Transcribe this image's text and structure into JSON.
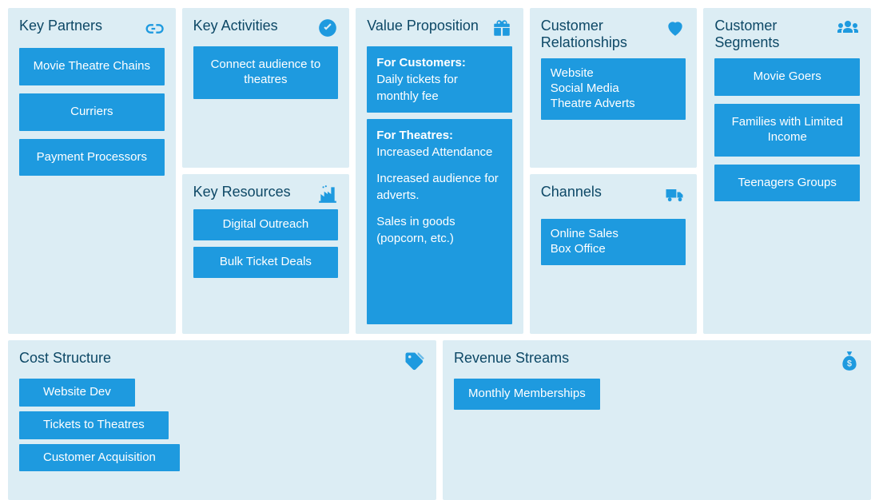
{
  "key_partners": {
    "title": "Key Partners",
    "items": [
      "Movie Theatre Chains",
      "Curriers",
      "Payment Processors"
    ]
  },
  "key_activities": {
    "title": "Key Activities",
    "items": [
      "Connect audience to theatres"
    ]
  },
  "key_resources": {
    "title": "Key Resources",
    "items": [
      "Digital Outreach",
      "Bulk Ticket Deals"
    ]
  },
  "value_proposition": {
    "title": "Value Proposition",
    "customers_heading": "For Customers:",
    "customers_body": "Daily tickets for monthly fee",
    "theatres_heading": "For Theatres:",
    "theatres_p1": "Increased Attendance",
    "theatres_p2": "Increased audience for adverts.",
    "theatres_p3": "Sales in goods (popcorn, etc.)"
  },
  "customer_relationships": {
    "title": "Customer Relationships",
    "lines": [
      "Website",
      "Social Media",
      "Theatre Adverts"
    ]
  },
  "channels": {
    "title": "Channels",
    "lines": [
      "Online Sales",
      "Box Office"
    ]
  },
  "customer_segments": {
    "title": "Customer Segments",
    "items": [
      "Movie Goers",
      "Families with Limited Income",
      "Teenagers Groups"
    ]
  },
  "cost_structure": {
    "title": "Cost Structure",
    "items": [
      "Website Dev",
      "Tickets to Theatres",
      "Customer Acquisition"
    ]
  },
  "revenue_streams": {
    "title": "Revenue Streams",
    "items": [
      "Monthly Memberships"
    ]
  }
}
